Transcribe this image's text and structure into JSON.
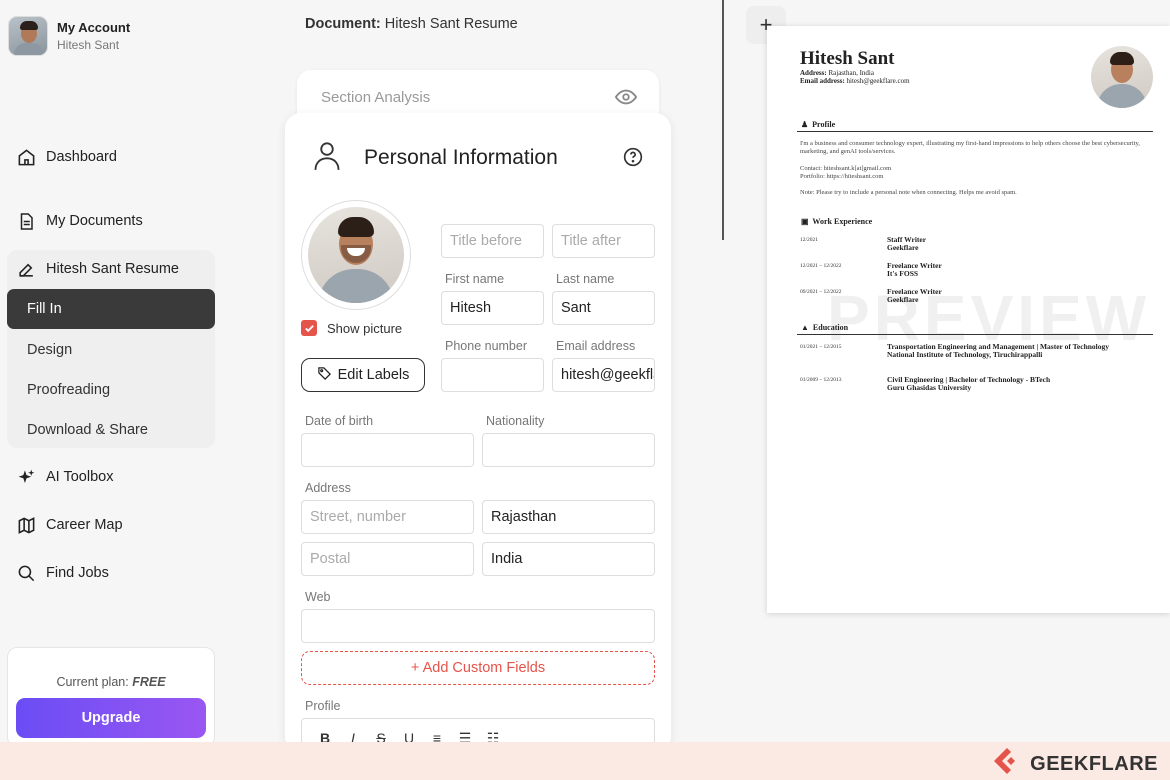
{
  "account": {
    "title": "My Account",
    "user": "Hitesh Sant"
  },
  "nav": {
    "dashboard": "Dashboard",
    "my_documents": "My Documents",
    "resume": "Hitesh Sant Resume",
    "fill_in": "Fill In",
    "design": "Design",
    "proofreading": "Proofreading",
    "download_share": "Download & Share",
    "ai_toolbox": "AI Toolbox",
    "career_map": "Career Map",
    "find_jobs": "Find Jobs"
  },
  "plan": {
    "label": "Current plan:",
    "value": "FREE",
    "upgrade": "Upgrade"
  },
  "document": {
    "label": "Document:",
    "name": "Hitesh Sant Resume"
  },
  "section_analysis": "Section Analysis",
  "personal_info": {
    "title": "Personal Information",
    "show_picture": "Show picture",
    "edit_labels": "Edit Labels",
    "title_before_ph": "Title before",
    "title_after_ph": "Title after",
    "first_name_label": "First name",
    "first_name": "Hitesh",
    "last_name_label": "Last name",
    "last_name": "Sant",
    "phone_label": "Phone number",
    "phone": "",
    "email_label": "Email address",
    "email": "hitesh@geekflare.com",
    "dob_label": "Date of birth",
    "nationality_label": "Nationality",
    "address_label": "Address",
    "street_ph": "Street, number",
    "state": "Rajasthan",
    "postal_ph": "Postal",
    "country": "India",
    "web_label": "Web",
    "add_custom": "+ Add Custom Fields",
    "profile_label": "Profile",
    "toolbar": [
      "B",
      "I",
      "S",
      "U",
      "≡",
      "☰",
      "☷"
    ]
  },
  "preview": {
    "name": "Hitesh Sant",
    "address_label": "Address:",
    "address": "Rajasthan, India",
    "email_label": "Email address:",
    "email": "hitesh@geekflare.com",
    "profile_heading": "Profile",
    "profile_text": "I'm a business and consumer technology expert, illustrating my first-hand impressions to help others choose the best cybersecurity, marketing, and genAI tools/services.",
    "contact": "Contact: hiteshsant.k[at]gmail.com",
    "portfolio": "Portfolio: https://hiteshsant.com",
    "note": "Note: Please try to include a personal note when connecting. Helps me avoid spam.",
    "work_heading": "Work Experience",
    "work": [
      {
        "date": "12/2021",
        "role": "Staff Writer",
        "org": "Geekflare"
      },
      {
        "date": "12/2021 – 12/2022",
        "role": "Freelance Writer",
        "org": "It's FOSS"
      },
      {
        "date": "09/2021 – 12/2022",
        "role": "Freelance Writer",
        "org": "Geekflare"
      }
    ],
    "education_heading": "Education",
    "education": [
      {
        "date": "01/2021 – 12/2015",
        "degree": "Transportation Engineering and Management | Master of Technology",
        "school": "National Institute of Technology, Tiruchirappalli"
      },
      {
        "date": "01/2009 – 12/2013",
        "degree": "Civil Engineering | Bachelor of Technology - BTech",
        "school": "Guru Ghasidas University"
      }
    ],
    "watermark": "PREVIEW"
  },
  "brand": "GEEKFLARE",
  "colors": {
    "accent": "#e5544b",
    "upgrade_start": "#6a4df5",
    "upgrade_end": "#9a57f2",
    "active_nav": "#3a3a3a"
  }
}
